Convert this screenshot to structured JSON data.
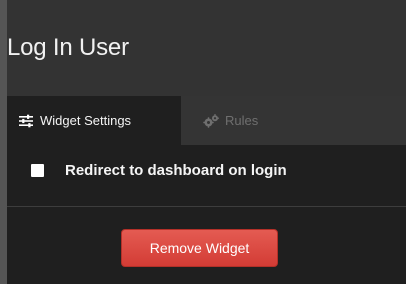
{
  "widget": {
    "title": "Log In User"
  },
  "tabs": [
    {
      "label": "Widget Settings",
      "icon": "sliders-icon",
      "active": true
    },
    {
      "label": "Rules",
      "icon": "gears-icon",
      "active": false
    }
  ],
  "settings": {
    "redirect_label": "Redirect to dashboard on login",
    "redirect_checked": false
  },
  "actions": {
    "remove_label": "Remove Widget"
  },
  "colors": {
    "background": "#1f1f1f",
    "header": "#333333",
    "danger": "#d9443c"
  }
}
